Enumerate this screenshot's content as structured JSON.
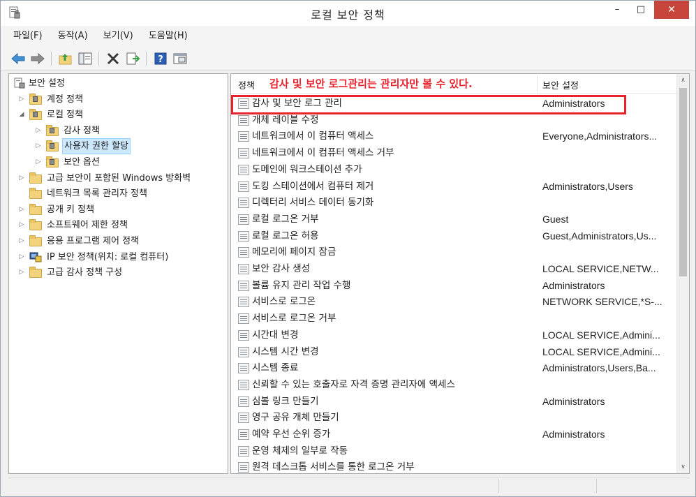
{
  "window": {
    "title": "로컬 보안 정책",
    "minimize_glyph": "–",
    "maximize_glyph": "□",
    "close_glyph": "✕"
  },
  "menu": {
    "items": [
      "파일(F)",
      "동작(A)",
      "보기(V)",
      "도움말(H)"
    ]
  },
  "toolbar": {
    "icons": [
      "back-arrow-icon",
      "forward-arrow-icon",
      "up-folder-icon",
      "show-hide-tree-icon",
      "delete-icon",
      "export-list-icon",
      "help-icon",
      "properties-icon"
    ]
  },
  "tree": {
    "root": "보안 설정",
    "items": [
      {
        "label": "계정 정책",
        "expander": "▷",
        "icon": "lock-folder-icon",
        "level": 1
      },
      {
        "label": "로컬 정책",
        "expander": "◢",
        "icon": "lock-folder-icon",
        "level": 1
      },
      {
        "label": "감사 정책",
        "expander": "▷",
        "icon": "lock-folder-icon",
        "level": 2
      },
      {
        "label": "사용자 권한 할당",
        "expander": "▷",
        "icon": "lock-folder-icon",
        "level": 2,
        "selected": true
      },
      {
        "label": "보안 옵션",
        "expander": "▷",
        "icon": "lock-folder-icon",
        "level": 2
      },
      {
        "label": "고급 보안이 포함된 Windows 방화벽",
        "expander": "▷",
        "icon": "folder-icon",
        "level": 1
      },
      {
        "label": "네트워크 목록 관리자 정책",
        "expander": "",
        "icon": "folder-icon",
        "level": 1
      },
      {
        "label": "공개 키 정책",
        "expander": "▷",
        "icon": "folder-icon",
        "level": 1
      },
      {
        "label": "소프트웨어 제한 정책",
        "expander": "▷",
        "icon": "folder-icon",
        "level": 1
      },
      {
        "label": "응용 프로그램 제어 정책",
        "expander": "▷",
        "icon": "folder-icon",
        "level": 1
      },
      {
        "label": "IP 보안 정책(위치: 로컬 컴퓨터)",
        "expander": "▷",
        "icon": "ip-security-icon",
        "level": 1
      },
      {
        "label": "고급 감사 정책 구성",
        "expander": "▷",
        "icon": "folder-icon",
        "level": 1
      }
    ]
  },
  "list": {
    "col_policy": "정책",
    "col_setting": "보안 설정",
    "annotation": "감사 및 보안 로그관리는 관리자만 볼 수 있다.",
    "annotation_color": "#e8232e",
    "rows": [
      {
        "name": "감사 및 보안 로그 관리",
        "setting": "Administrators"
      },
      {
        "name": "개체 레이블 수정",
        "setting": ""
      },
      {
        "name": "네트워크에서 이 컴퓨터 액세스",
        "setting": "Everyone,Administrators..."
      },
      {
        "name": "네트워크에서 이 컴퓨터 액세스 거부",
        "setting": ""
      },
      {
        "name": "도메인에 워크스테이션 추가",
        "setting": ""
      },
      {
        "name": "도킹 스테이션에서 컴퓨터 제거",
        "setting": "Administrators,Users"
      },
      {
        "name": "디렉터리 서비스 데이터 동기화",
        "setting": ""
      },
      {
        "name": "로컬 로그온 거부",
        "setting": "Guest"
      },
      {
        "name": "로컬 로그온 허용",
        "setting": "Guest,Administrators,Us..."
      },
      {
        "name": "메모리에 페이지 잠금",
        "setting": ""
      },
      {
        "name": "보안 감사 생성",
        "setting": "LOCAL SERVICE,NETW..."
      },
      {
        "name": "볼륨 유지 관리 작업 수행",
        "setting": "Administrators"
      },
      {
        "name": "서비스로 로그온",
        "setting": "NETWORK SERVICE,*S-..."
      },
      {
        "name": "서비스로 로그온 거부",
        "setting": ""
      },
      {
        "name": "시간대 변경",
        "setting": "LOCAL SERVICE,Admini..."
      },
      {
        "name": "시스템 시간 변경",
        "setting": "LOCAL SERVICE,Admini..."
      },
      {
        "name": "시스템 종료",
        "setting": "Administrators,Users,Ba..."
      },
      {
        "name": "신뢰할 수 있는 호출자로 자격 증명 관리자에 액세스",
        "setting": ""
      },
      {
        "name": "심볼 링크 만들기",
        "setting": "Administrators"
      },
      {
        "name": "영구 공유 개체 만들기",
        "setting": ""
      },
      {
        "name": "예약 우선 순위 증가",
        "setting": "Administrators"
      },
      {
        "name": "운영 체제의 일부로 작동",
        "setting": ""
      },
      {
        "name": "원격 데스크톱 서비스를 통한 로그온 거부",
        "setting": ""
      }
    ]
  },
  "scrollbar": {
    "up_glyph": "∧",
    "down_glyph": "∨"
  }
}
